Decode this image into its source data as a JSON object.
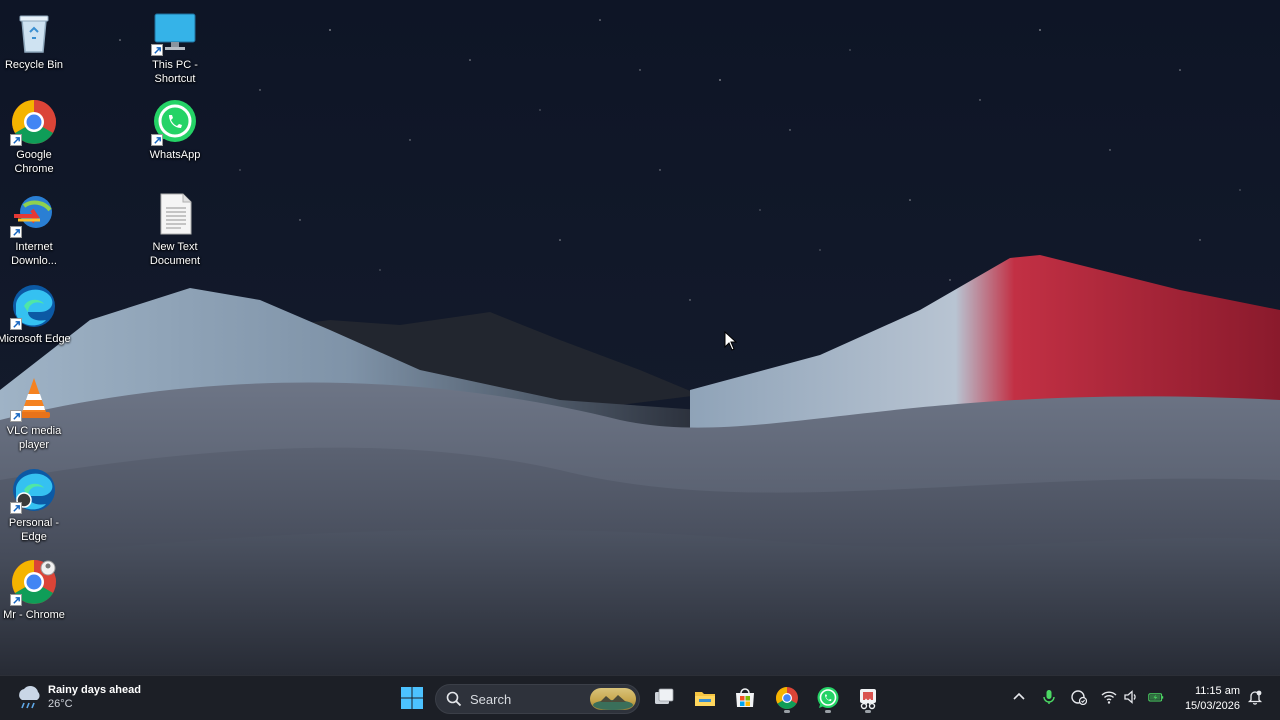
{
  "desktop": {
    "icons": [
      {
        "label": "Recycle Bin",
        "icon": "recycle-bin-icon",
        "shortcut": false
      },
      {
        "label": "This PC - Shortcut",
        "icon": "this-pc-icon",
        "shortcut": true
      },
      {
        "label": "Google Chrome",
        "icon": "chrome-icon",
        "shortcut": true
      },
      {
        "label": "WhatsApp",
        "icon": "whatsapp-icon",
        "shortcut": true
      },
      {
        "label": "Internet Downlo...",
        "icon": "internet-download-manager-icon",
        "shortcut": true
      },
      {
        "label": "New Text Document",
        "icon": "text-document-icon",
        "shortcut": false
      },
      {
        "label": "Microsoft Edge",
        "icon": "edge-icon",
        "shortcut": true
      },
      {
        "label": "VLC media player",
        "icon": "vlc-icon",
        "shortcut": true
      },
      {
        "label": "Personal - Edge",
        "icon": "edge-profile-icon",
        "shortcut": true
      },
      {
        "label": "Mr - Chrome",
        "icon": "chrome-profile-icon",
        "shortcut": true
      }
    ]
  },
  "taskbar": {
    "weather": {
      "title": "Rainy days ahead",
      "temp": "26°C",
      "icon": "rain-cloud-icon"
    },
    "search": {
      "placeholder": "Search"
    },
    "apps": [
      {
        "name": "Start",
        "icon": "windows-start-icon"
      },
      {
        "name": "Task View",
        "icon": "task-view-icon"
      },
      {
        "name": "File Explorer",
        "icon": "file-explorer-icon"
      },
      {
        "name": "Microsoft Store",
        "icon": "store-icon"
      },
      {
        "name": "Google Chrome",
        "icon": "chrome-icon",
        "running": true
      },
      {
        "name": "WhatsApp",
        "icon": "whatsapp-icon",
        "running": true
      },
      {
        "name": "Snipping Tool",
        "icon": "snipping-tool-icon",
        "running": true
      }
    ],
    "tray": {
      "icons": [
        "chevron-up-icon",
        "microphone-icon",
        "security-icon",
        "wifi-icon",
        "volume-icon",
        "battery-charging-icon",
        "notification-bell-icon"
      ]
    },
    "clock": {
      "time": "11:15 am",
      "date": "15/03/2026"
    }
  },
  "colors": {
    "taskbar_bg": "#1c1f26",
    "sky": "#0b1020",
    "mountain_red": "#c0293c",
    "dune": "#5a6170"
  }
}
